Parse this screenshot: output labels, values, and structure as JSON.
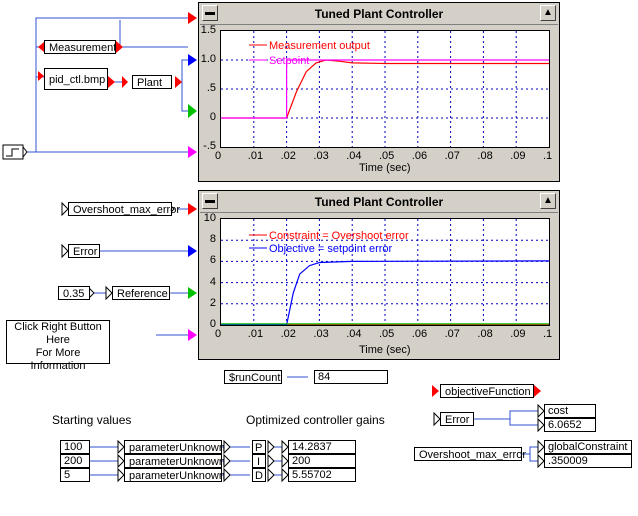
{
  "colors": {
    "red": "#ff0000",
    "magenta": "#ff00ff",
    "blue": "#0000ff",
    "green": "#00c000",
    "wire": "#3050d0",
    "panel_bg": "#d4d0c8"
  },
  "blocks": {
    "measurement": "Measurement",
    "pid": "pid_ctl.bmp",
    "plant": "Plant",
    "overshoot": "Overshoot_max_error",
    "error": "Error",
    "const_val": "0.35",
    "reference": "Reference",
    "runcount": "$runCount",
    "runcount_val": "84",
    "objective": "objectiveFunction",
    "error2": "Error",
    "cost": "cost",
    "cost_val": "6.0652",
    "overshoot2": "Overshoot_max_error",
    "gconstraint": "globalConstraint",
    "gconstraint_val": ".350009"
  },
  "info_text": [
    "Click Right Button",
    "Here",
    "For More Information"
  ],
  "starting_values_label": "Starting values",
  "gains_label": "Optimized controller gains",
  "params": [
    {
      "start": "100",
      "block": "parameterUnknown",
      "gain": "P",
      "value": "14.2837"
    },
    {
      "start": "200",
      "block": "parameterUnknown",
      "gain": "I",
      "value": "200"
    },
    {
      "start": "5",
      "block": "parameterUnknown",
      "gain": "D",
      "value": "5.55702"
    }
  ],
  "chart_data": [
    {
      "type": "line",
      "title": "Tuned Plant Controller",
      "xlabel": "Time (sec)",
      "ylabel": "",
      "xlim": [
        0,
        0.1
      ],
      "ylim": [
        -0.5,
        1.5
      ],
      "x_ticks": [
        "0",
        ".01",
        ".02",
        ".03",
        ".04",
        ".05",
        ".06",
        ".07",
        ".08",
        ".09",
        ".1"
      ],
      "y_ticks": [
        "1.5",
        "1.0",
        ".5",
        "0",
        "-.5"
      ],
      "legend": [
        "Measurement output",
        "Setpoint"
      ],
      "grid": true,
      "series": [
        {
          "name": "Measurement output",
          "color": "#ff0000",
          "x": [
            0,
            0.02,
            0.023,
            0.026,
            0.029,
            0.032,
            0.036,
            0.04,
            0.05,
            0.1
          ],
          "y": [
            0,
            0,
            0.45,
            0.8,
            0.95,
            1.0,
            0.98,
            0.95,
            0.94,
            0.94
          ]
        },
        {
          "name": "Setpoint",
          "color": "#ff00ff",
          "x": [
            0,
            0.02,
            0.02,
            0.1
          ],
          "y": [
            0,
            0,
            1.0,
            1.0
          ]
        }
      ]
    },
    {
      "type": "line",
      "title": "Tuned Plant Controller",
      "xlabel": "Time (sec)",
      "ylabel": "",
      "xlim": [
        0,
        0.1
      ],
      "ylim": [
        0,
        10
      ],
      "x_ticks": [
        "0",
        ".01",
        ".02",
        ".03",
        ".04",
        ".05",
        ".06",
        ".07",
        ".08",
        ".09",
        ".1"
      ],
      "y_ticks": [
        "10",
        "8",
        "6",
        "4",
        "2",
        "0"
      ],
      "legend": [
        "Constraint = Overshoot error",
        "Objective = setpoint error"
      ],
      "grid": true,
      "series": [
        {
          "name": "Constraint = Overshoot error",
          "color": "#ff0000",
          "x": [
            0,
            0.1
          ],
          "y": [
            0,
            0
          ]
        },
        {
          "name": "Objective = setpoint error",
          "color": "#0000ff",
          "x": [
            0,
            0.02,
            0.022,
            0.024,
            0.027,
            0.03,
            0.04,
            0.1
          ],
          "y": [
            0,
            0,
            3.0,
            4.8,
            5.6,
            5.9,
            6.0,
            6.05
          ]
        },
        {
          "name": "",
          "color": "#00c000",
          "x": [
            0,
            0.1
          ],
          "y": [
            0.1,
            0.1
          ]
        }
      ]
    }
  ]
}
